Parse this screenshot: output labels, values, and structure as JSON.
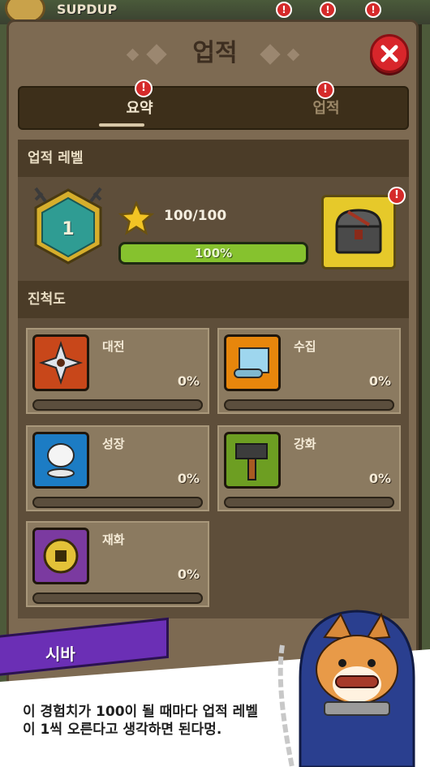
{
  "background": {
    "title": "SUPDUP",
    "badges": [
      "!",
      "!",
      "!"
    ]
  },
  "dialog_title": "업적",
  "tabs": [
    {
      "label": "요약",
      "active": true,
      "alert": "!"
    },
    {
      "label": "업적",
      "active": false,
      "alert": "!"
    }
  ],
  "level_section": {
    "header": "업적 레벨",
    "level": "1",
    "exp_text": "100/100",
    "exp_percent_label": "100%",
    "exp_progress": 1.0,
    "reward_alert": "!"
  },
  "progress_section": {
    "header": "진척도",
    "cards": [
      {
        "name": "대전",
        "percent_label": "0%",
        "progress": 0,
        "icon": "shuriken-vs-icon",
        "color": "#c8471a"
      },
      {
        "name": "수집",
        "percent_label": "0%",
        "progress": 0,
        "icon": "scroll-icon",
        "color": "#e7860c"
      },
      {
        "name": "성장",
        "percent_label": "0%",
        "progress": 0,
        "icon": "rice-cake-icon",
        "color": "#1c7cc4"
      },
      {
        "name": "강화",
        "percent_label": "0%",
        "progress": 0,
        "icon": "hammer-icon",
        "color": "#6d9e22"
      },
      {
        "name": "재화",
        "percent_label": "0%",
        "progress": 0,
        "icon": "coin-icon",
        "color": "#7b3aa0"
      }
    ]
  },
  "character": {
    "name": "시바",
    "dialog": "이 경험치가 100이 될 때마다 업적 레벨이 1씩 오른다고 생각하면 된다멍."
  },
  "colors": {
    "panel": "#7d6a52",
    "accent_green": "#86c22e",
    "close_red": "#d8262b",
    "banner_purple": "#6b2fb5"
  }
}
